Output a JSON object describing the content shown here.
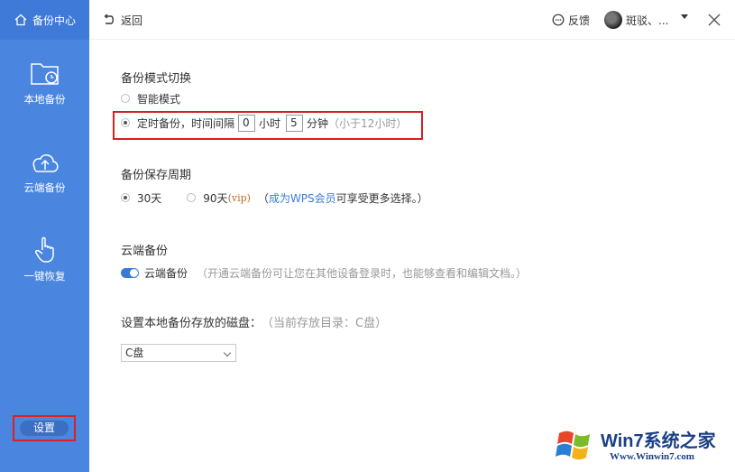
{
  "sidebar": {
    "header_label": "备份中心",
    "items": [
      {
        "label": "本地备份",
        "icon": "folder-clock-icon"
      },
      {
        "label": "云端备份",
        "icon": "cloud-upload-icon"
      },
      {
        "label": "一键恢复",
        "icon": "hand-pointer-icon"
      }
    ],
    "settings_label": "设置"
  },
  "topbar": {
    "back_label": "返回",
    "feedback_label": "反馈",
    "user_name": "斑驳、..."
  },
  "backup_mode": {
    "title": "备份模式切换",
    "smart_label": "智能模式",
    "timed_label": "定时备份，时间间隔",
    "hours_value": "0",
    "hours_unit": "小时",
    "minutes_value": "5",
    "minutes_unit": "分钟",
    "hint": "（小于12小时）",
    "selected": "timed"
  },
  "retention": {
    "title": "备份保存周期",
    "opt_30": "30天",
    "opt_90": "90天",
    "vip_tag": "(vip)",
    "note_prefix": "（",
    "note_link": "成为WPS会员",
    "note_suffix": " 可享受更多选择。）",
    "selected": "30天"
  },
  "cloud": {
    "title": "云端备份",
    "toggle_label": "云端备份",
    "toggle_on": true,
    "description": "（开通云端备份可让您在其他设备登录时，也能够查看和编辑文档。）"
  },
  "disk": {
    "title": "设置本地备份存放的磁盘：",
    "current_dir": "（当前存放目录：C盘）",
    "selected": "C盘"
  },
  "watermark": {
    "title": "Win7系统之家",
    "url": "Www.Winwin7.com"
  },
  "colors": {
    "sidebar": "#4a86e0",
    "accent": "#3a7bd5",
    "highlight_border": "#d82020"
  }
}
